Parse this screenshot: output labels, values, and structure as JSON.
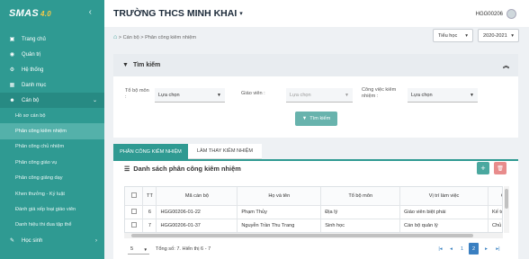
{
  "app": {
    "logo": "SMAS",
    "version": "4.0"
  },
  "header": {
    "school": "TRƯỜNG THCS MINH KHAI",
    "user": "HGG00206"
  },
  "sidebar": {
    "items": [
      {
        "label": "Trang chủ",
        "icon": "dashboard-icon"
      },
      {
        "label": "Quản trị",
        "icon": "admin-icon"
      },
      {
        "label": "Hệ thống",
        "icon": "system-icon"
      },
      {
        "label": "Danh mục",
        "icon": "grid-icon"
      },
      {
        "label": "Cán bộ",
        "icon": "user-icon"
      }
    ],
    "sub_items": [
      {
        "label": "Hồ sơ cán bộ"
      },
      {
        "label": "Phân công kiêm nhiệm"
      },
      {
        "label": "Phân công chủ nhiệm"
      },
      {
        "label": "Phân công giáo vụ"
      },
      {
        "label": "Phân công giảng dạy"
      },
      {
        "label": "Khen thưởng - Kỷ luật"
      },
      {
        "label": "Đánh giá xếp loại giáo viên"
      },
      {
        "label": "Danh hiệu thi đua tập thể"
      }
    ],
    "last_item": {
      "label": "Học sinh"
    }
  },
  "breadcrumb": {
    "items": [
      "Cán bộ",
      "Phân công kiêm nhiệm"
    ],
    "separator": ">"
  },
  "selectors": {
    "level": "Tiểu học",
    "year": "2020-2021"
  },
  "search": {
    "title": "Tìm kiếm",
    "fields": {
      "to_bo_mon": {
        "label": "Tổ bộ môn",
        "label2": ":",
        "value": "Lựa chọn"
      },
      "giao_vien": {
        "label": "Giáo viên :",
        "value": "Lựa chọn"
      },
      "cong_viec": {
        "label": "Công việc kiêm",
        "label2": "nhiệm :",
        "value": "Lựa chọn"
      }
    },
    "button": "Tìm kiếm"
  },
  "tabs": [
    {
      "label": "PHÂN CÔNG KIÊM NHIỆM",
      "active": true
    },
    {
      "label": "LÀM THAY KIÊM NHIỆM",
      "active": false
    }
  ],
  "list": {
    "title": "Danh sách phân công kiêm nhiệm",
    "columns": [
      "TT",
      "Mã cán bộ",
      "Họ và tên",
      "Tổ bộ môn",
      "Vị trí làm việc",
      "Công"
    ],
    "rows": [
      {
        "tt": "6",
        "ma": "HGG00206-01-22",
        "ten": "Phạm Thủy",
        "to": "Địa lý",
        "vitri": "Giáo viên biệt phái",
        "cong": "Kế toán"
      },
      {
        "tt": "7",
        "ma": "HGG00206-01-37",
        "ten": "Nguyễn Trần Thu Trang",
        "to": "Sinh học",
        "vitri": "Cán bộ quản lý",
        "cong": "Chủ nhiệ"
      }
    ]
  },
  "pagination": {
    "page_size": "5",
    "summary": "Tổng số: 7. Hiển thị 6 - 7",
    "pages": [
      "1",
      "2"
    ],
    "current": "2"
  },
  "colors": {
    "primary": "#2f9a92",
    "sidebar": "#2f9a92",
    "active_page": "#3a7fc1"
  }
}
